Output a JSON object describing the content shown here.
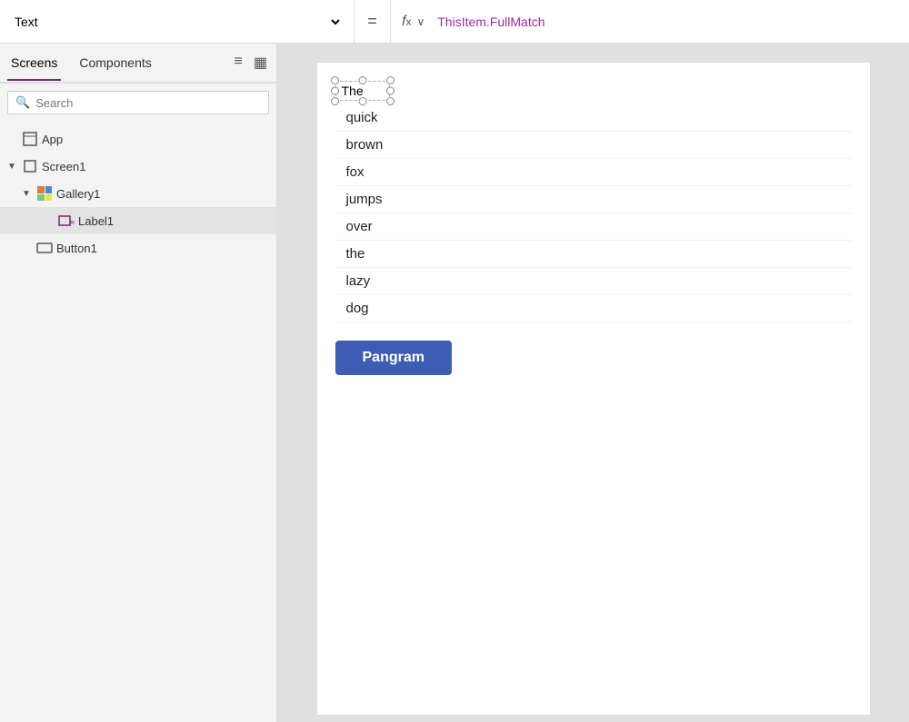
{
  "topbar": {
    "property_value": "Text",
    "equals_sign": "=",
    "fx_label": "f",
    "x_label": "x",
    "formula": "ThisItem.FullMatch"
  },
  "sidebar": {
    "tabs": [
      {
        "id": "screens",
        "label": "Screens",
        "active": true
      },
      {
        "id": "components",
        "label": "Components",
        "active": false
      }
    ],
    "list_icon_title": "list view",
    "grid_icon_title": "grid view",
    "search_placeholder": "Search",
    "tree": [
      {
        "id": "app",
        "label": "App",
        "indent": 1,
        "icon": "app",
        "expanded": false,
        "chevron": ""
      },
      {
        "id": "screen1",
        "label": "Screen1",
        "indent": 1,
        "icon": "screen",
        "expanded": true,
        "chevron": "▼"
      },
      {
        "id": "gallery1",
        "label": "Gallery1",
        "indent": 2,
        "icon": "gallery",
        "expanded": true,
        "chevron": "▼"
      },
      {
        "id": "label1",
        "label": "Label1",
        "indent": 3,
        "icon": "label",
        "expanded": false,
        "chevron": "",
        "selected": true
      },
      {
        "id": "button1",
        "label": "Button1",
        "indent": 2,
        "icon": "button",
        "expanded": false,
        "chevron": ""
      }
    ]
  },
  "canvas": {
    "selected_text": "The",
    "gallery_items": [
      "quick",
      "brown",
      "fox",
      "jumps",
      "over",
      "the",
      "lazy",
      "dog"
    ],
    "button_label": "Pangram"
  }
}
